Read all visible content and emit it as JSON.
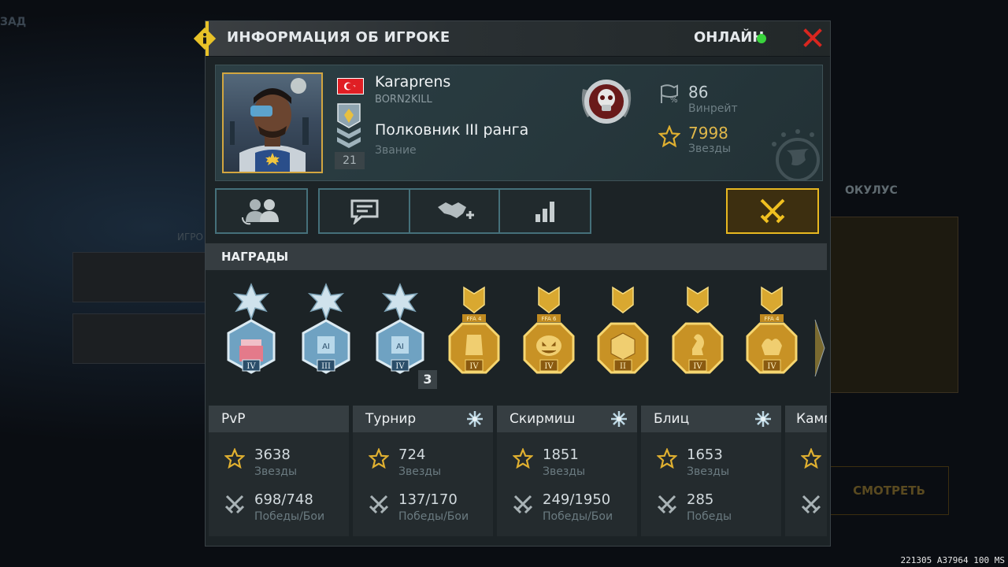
{
  "background": {
    "left_tab": "ЗАД",
    "left_label": "ИГРО",
    "right_title": "ОКУЛУС",
    "right_button": "СМОТРЕТЬ"
  },
  "footer_code": "221305 A37964 100 MS",
  "dialog": {
    "title": "ИНФОРМАЦИЯ ОБ ИГРОКЕ",
    "status": "ОНЛАЙН",
    "status_color": "#39d43d",
    "close_icon": "close-x-icon"
  },
  "profile": {
    "name": "Karaprens",
    "clan": "BORN2KILL",
    "flag": "turkey-flag",
    "rank_name": "Полковник III ранга",
    "rank_label": "Звание",
    "level": "21",
    "winrate_value": "86",
    "winrate_label": "Винрейт",
    "stars_value": "7998",
    "stars_label": "Звезды"
  },
  "actions": [
    {
      "name": "compare-players",
      "icon": "players-swap-icon"
    },
    {
      "name": "chat",
      "icon": "chat-icon"
    },
    {
      "name": "add-friend",
      "icon": "handshake-plus-icon"
    },
    {
      "name": "statistics",
      "icon": "bar-chart-icon"
    },
    {
      "name": "challenge",
      "icon": "crossed-swords-icon",
      "active": true
    }
  ],
  "awards": {
    "title": "НАГРАДЫ",
    "medals": [
      {
        "type": "silver",
        "emblem": "cake",
        "tier": "IV"
      },
      {
        "type": "silver",
        "emblem": "AI",
        "tier": "III"
      },
      {
        "type": "silver",
        "emblem": "AI",
        "tier": "IV",
        "count": "3"
      },
      {
        "type": "gold",
        "emblem": "FFA 4",
        "tier": "IV"
      },
      {
        "type": "gold",
        "emblem": "FFA 6 pumpkin",
        "tier": "IV"
      },
      {
        "type": "gold",
        "emblem": "crate",
        "tier": "II"
      },
      {
        "type": "gold",
        "emblem": "chess",
        "tier": "IV"
      },
      {
        "type": "gold",
        "emblem": "FFA 4",
        "tier": "IV"
      }
    ]
  },
  "modes": [
    {
      "title": "PvP",
      "snow": false,
      "stars": "3638",
      "stars_label": "Звезды",
      "battles": "698/748",
      "battles_label": "Победы/Бои"
    },
    {
      "title": "Турнир",
      "snow": true,
      "stars": "724",
      "stars_label": "Звезды",
      "battles": "137/170",
      "battles_label": "Победы/Бои"
    },
    {
      "title": "Скирмиш",
      "snow": true,
      "stars": "1851",
      "stars_label": "Звезды",
      "battles": "249/1950",
      "battles_label": "Победы/Бои"
    },
    {
      "title": "Блиц",
      "snow": true,
      "stars": "1653",
      "stars_label": "Звезды",
      "battles": "285",
      "battles_label": "Победы"
    },
    {
      "title": "Камп",
      "snow": false
    }
  ]
}
